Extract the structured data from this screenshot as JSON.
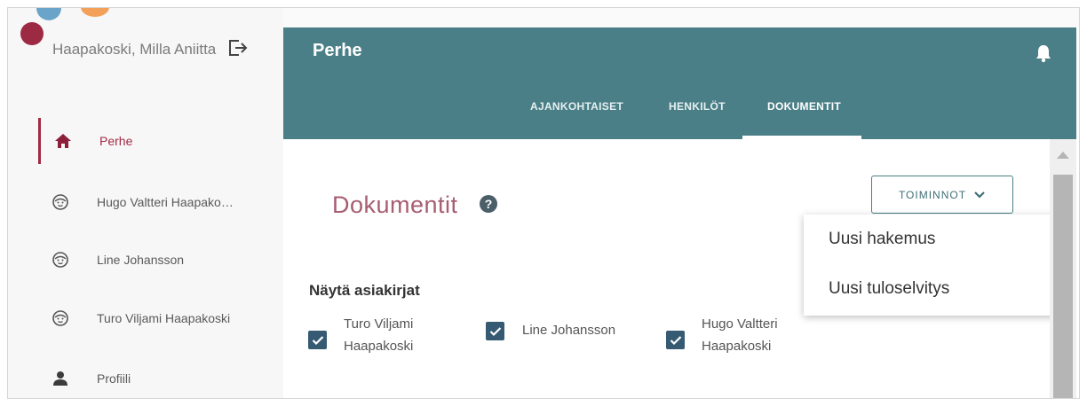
{
  "sidebar": {
    "user_name": "Haapakoski, Milla Aniitta",
    "items": [
      {
        "label": "Perhe",
        "icon": "home-icon",
        "active": true
      },
      {
        "label": "Hugo Valtteri Haapako…",
        "icon": "child-face-icon",
        "active": false
      },
      {
        "label": "Line Johansson",
        "icon": "child-face-icon",
        "active": false
      },
      {
        "label": "Turo Viljami Haapakoski",
        "icon": "child-face-icon",
        "active": false
      },
      {
        "label": "Profiili",
        "icon": "person-icon",
        "active": false
      }
    ]
  },
  "header": {
    "title": "Perhe",
    "tabs": [
      {
        "label": "AJANKOHTAISET"
      },
      {
        "label": "HENKILÖT"
      },
      {
        "label": "DOKUMENTIT",
        "active": true
      }
    ]
  },
  "main": {
    "page_title": "Dokumentit",
    "help_symbol": "?",
    "actions_button": "TOIMINNOT",
    "actions_menu": [
      {
        "label": "Uusi hakemus"
      },
      {
        "label": "Uusi tuloselvitys"
      }
    ],
    "filter_title": "Näytä asiakirjat",
    "filters": [
      {
        "label_lines": [
          "Turo Viljami",
          "Haapakoski"
        ],
        "checked": true
      },
      {
        "label_lines": [
          "Line Johansson"
        ],
        "checked": true
      },
      {
        "label_lines": [
          "Hugo Valtteri",
          "Haapakoski"
        ],
        "checked": true
      }
    ]
  },
  "colors": {
    "accent": "#a12a45",
    "header_bg": "#4b7f87",
    "checkbox": "#355a72"
  }
}
